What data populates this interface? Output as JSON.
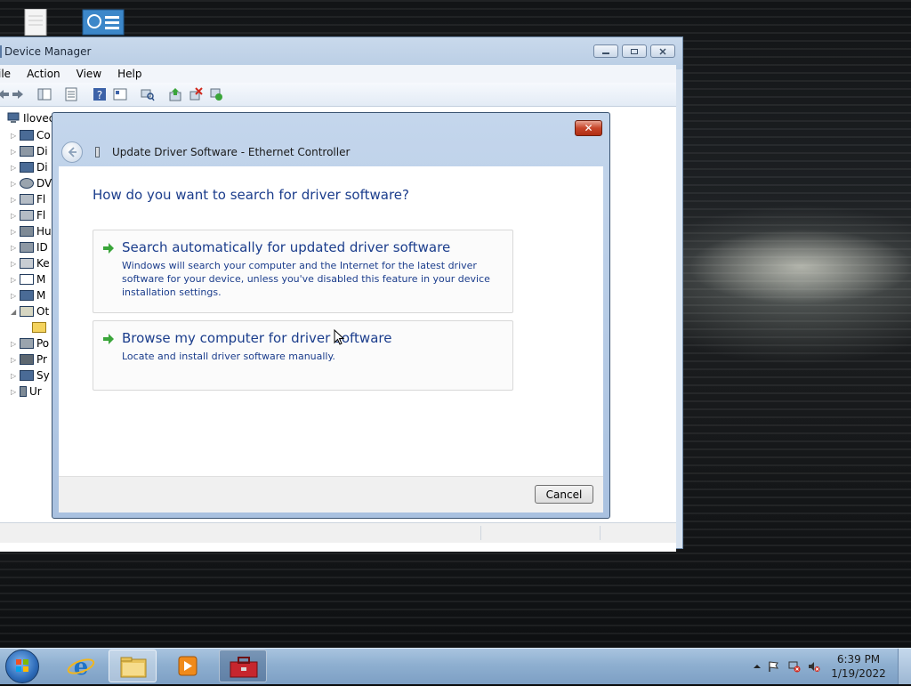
{
  "device_manager": {
    "title": "Device Manager",
    "menu": [
      "ile",
      "Action",
      "View",
      "Help"
    ],
    "tree_root": "Ilovec",
    "tree_items": [
      "Co",
      "Di",
      "Di",
      "DV",
      "Fl",
      "Fl",
      "Hu",
      "ID",
      "Ke",
      "M",
      "M",
      "Ot",
      "",
      "Po",
      "Pr",
      "Sy",
      "Ur"
    ]
  },
  "dialog": {
    "close_label": "✕",
    "title": "Update Driver Software - Ethernet Controller",
    "question": "How do you want to search for driver software?",
    "option_auto": {
      "title": "Search automatically for updated driver software",
      "description": "Windows will search your computer and the Internet for the latest driver software for your device, unless you've disabled this feature in your device installation settings."
    },
    "option_browse": {
      "title": "Browse my computer for driver software",
      "description": "Locate and install driver software manually."
    },
    "cancel_label": "Cancel"
  },
  "taskbar": {
    "time": "6:39 PM",
    "date": "1/19/2022",
    "pinned": [
      "internet-explorer",
      "windows-explorer",
      "media-player",
      "device-manager"
    ]
  },
  "colors": {
    "accent_text": "#1b3d8c",
    "close_red": "#c7452b",
    "option_arrow": "#3aa53a"
  }
}
